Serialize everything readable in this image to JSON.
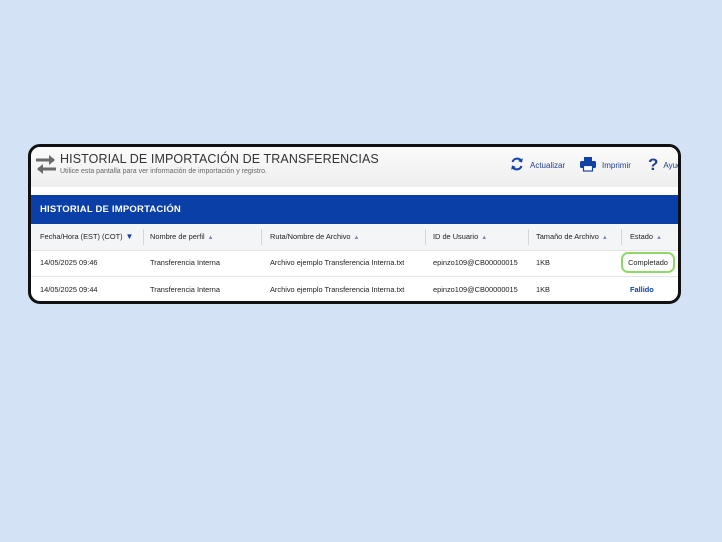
{
  "header": {
    "title": "HISTORIAL DE IMPORTACIÓN DE TRANSFERENCIAS",
    "subtitle": "Utilice esta pantalla para ver información de importación y registro.",
    "icon": "transfer-arrows-icon"
  },
  "toolbar": {
    "refresh": {
      "label": "Actualizar",
      "icon": "refresh-icon"
    },
    "print": {
      "label": "Imprimir",
      "icon": "printer-icon"
    },
    "help": {
      "label": "Ayuda",
      "icon": "question-icon"
    }
  },
  "section": {
    "title": "HISTORIAL DE IMPORTACIÓN"
  },
  "table": {
    "columns": [
      {
        "label": "Fecha/Hora (EST) (COT)",
        "sorted": "desc"
      },
      {
        "label": "Nombre de perfil",
        "sorted": "none"
      },
      {
        "label": "Ruta/Nombre de Archivo",
        "sorted": "none"
      },
      {
        "label": "ID de Usuario",
        "sorted": "none"
      },
      {
        "label": "Tamaño de Archivo",
        "sorted": "none"
      },
      {
        "label": "Estado",
        "sorted": "none"
      }
    ],
    "rows": [
      [
        "14/05/2025 09:46",
        "Transferencia Interna",
        "Archivo ejemplo Transferencia Interna.txt",
        "epinzo109@CB00000015",
        "1KB",
        "Completado"
      ],
      [
        "14/05/2025 09:44",
        "Transferencia Interna",
        "Archivo ejemplo Transferencia Interna.txt",
        "epinzo109@CB00000015",
        "1KB",
        "Fallido"
      ]
    ]
  },
  "colors": {
    "background": "#d3e3f5",
    "section_bar": "#0b3fa8",
    "accent": "#1242a6",
    "completed_highlight": "#90d86a"
  }
}
